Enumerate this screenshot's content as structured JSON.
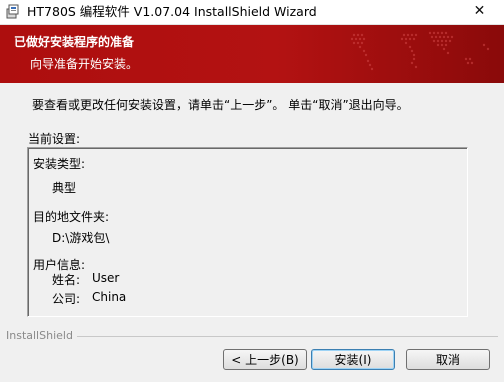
{
  "window": {
    "title": "HT780S 编程软件 V1.07.04 InstallShield Wizard",
    "close_glyph": "✕"
  },
  "banner": {
    "title": "已做好安装程序的准备",
    "subtitle": "向导准备开始安装。"
  },
  "instruction": "要查看或更改任何安装设置，请单击“上一步”。 单击“取消”退出向导。",
  "settings": {
    "label": "当前设置:",
    "setup_type_label": "安装类型:",
    "setup_type_value": "典型",
    "destination_label": "目的地文件夹:",
    "destination_value": "D:\\游戏包\\",
    "user_info_label": "用户信息:",
    "name_label": "姓名:",
    "name_value": "User",
    "company_label": "公司:",
    "company_value": "China"
  },
  "brand": "InstallShield",
  "buttons": {
    "back": "< 上一步(B)",
    "install": "安装(I)",
    "cancel": "取消"
  },
  "icons": {
    "app": "installer-box-icon",
    "close": "close-icon",
    "banner_art": "world-map-icon"
  },
  "colors": {
    "banner": "#b31212",
    "window_bg": "#f0f0f0"
  }
}
